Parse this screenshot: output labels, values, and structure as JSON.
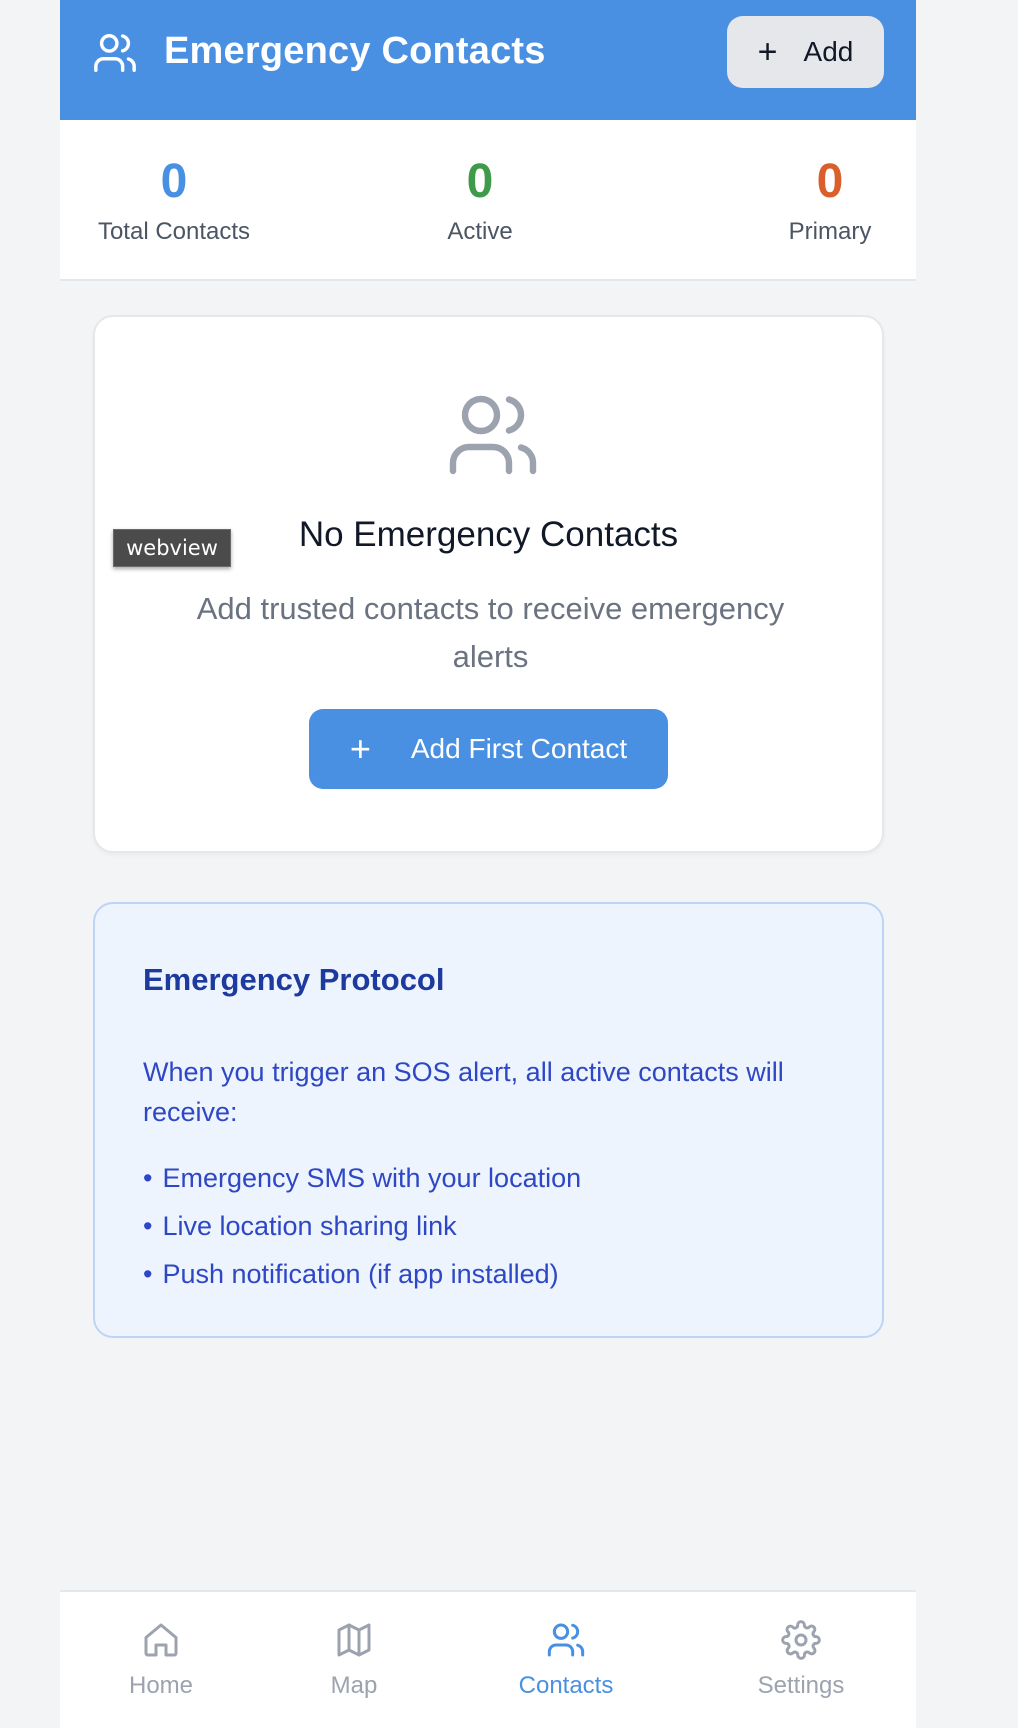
{
  "header": {
    "title": "Emergency Contacts",
    "add_label": "Add",
    "add_icon": "plus-icon",
    "title_icon": "users-icon"
  },
  "stats": {
    "total": {
      "value": "0",
      "label": "Total Contacts",
      "color": "#4a90e2"
    },
    "active": {
      "value": "0",
      "label": "Active",
      "color": "#3f9a4a"
    },
    "primary": {
      "value": "0",
      "label": "Primary",
      "color": "#d9602a"
    }
  },
  "empty_state": {
    "icon": "users-icon",
    "title": "No Emergency Contacts",
    "description": "Add trusted contacts to receive emergency alerts",
    "button_label": "Add First Contact"
  },
  "webview_tag": "webview",
  "protocol": {
    "title": "Emergency Protocol",
    "text": "When you trigger an SOS alert, all active contacts will receive:",
    "items": [
      "Emergency SMS with your location",
      "Live location sharing link",
      "Push notification (if app installed)"
    ]
  },
  "nav": {
    "items": [
      {
        "label": "Home",
        "icon": "home-icon",
        "active": false
      },
      {
        "label": "Map",
        "icon": "map-icon",
        "active": false
      },
      {
        "label": "Contacts",
        "icon": "users-icon",
        "active": true
      },
      {
        "label": "Settings",
        "icon": "gear-icon",
        "active": false
      }
    ]
  },
  "colors": {
    "primary": "#4a90e2",
    "background": "#f3f4f6",
    "protocol_bg": "#edf4fe",
    "protocol_text": "#2e47c4"
  }
}
